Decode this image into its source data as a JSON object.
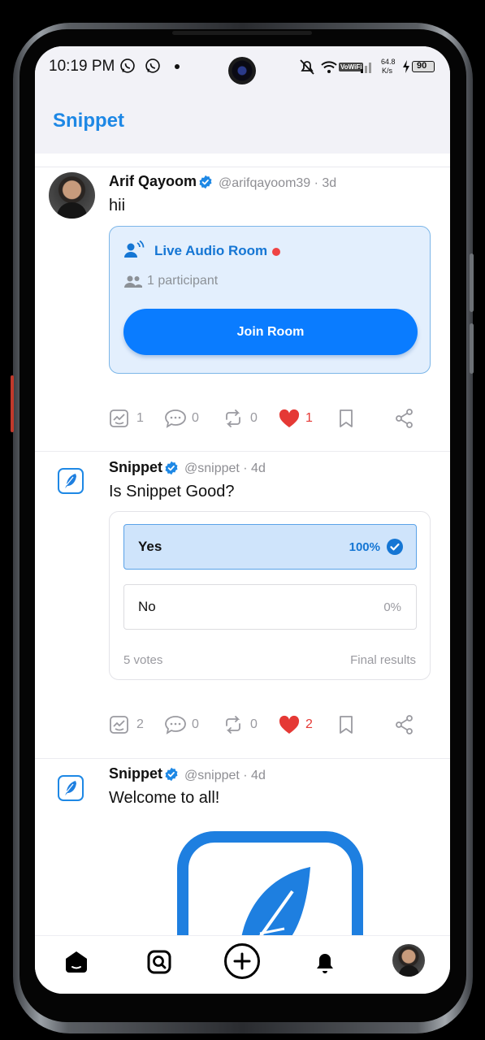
{
  "status_bar": {
    "time": "10:19 PM",
    "net_speed_top": "64.8",
    "net_speed_unit": "K/s",
    "vowifi": "VoWiFi",
    "battery": "90"
  },
  "header": {
    "title": "Snippet"
  },
  "posts": [
    {
      "name": "Arif Qayoom",
      "handle": "@arifqayoom39 · 3d",
      "text": "hii",
      "audio_room": {
        "title": "Live Audio Room",
        "participants": "1 participant",
        "join_label": "Join Room"
      },
      "actions": {
        "views": "1",
        "comments": "0",
        "reposts": "0",
        "likes": "1"
      }
    },
    {
      "name": "Snippet",
      "handle": "@snippet · 4d",
      "text": "Is Snippet Good?",
      "poll": {
        "options": [
          {
            "label": "Yes",
            "percent": "100%",
            "selected": true
          },
          {
            "label": "No",
            "percent": "0%",
            "selected": false
          }
        ],
        "votes": "5 votes",
        "status": "Final results"
      },
      "actions": {
        "views": "2",
        "comments": "0",
        "reposts": "0",
        "likes": "2"
      }
    },
    {
      "name": "Snippet",
      "handle": "@snippet · 4d",
      "text": "Welcome to all!"
    }
  ],
  "nav": [
    "home-icon",
    "search-icon",
    "compose-icon",
    "notifications-icon",
    "profile-avatar"
  ],
  "colors": {
    "accent": "#1e88e5",
    "button": "#0a7cff",
    "like": "#e53935",
    "live": "#ef4444"
  }
}
